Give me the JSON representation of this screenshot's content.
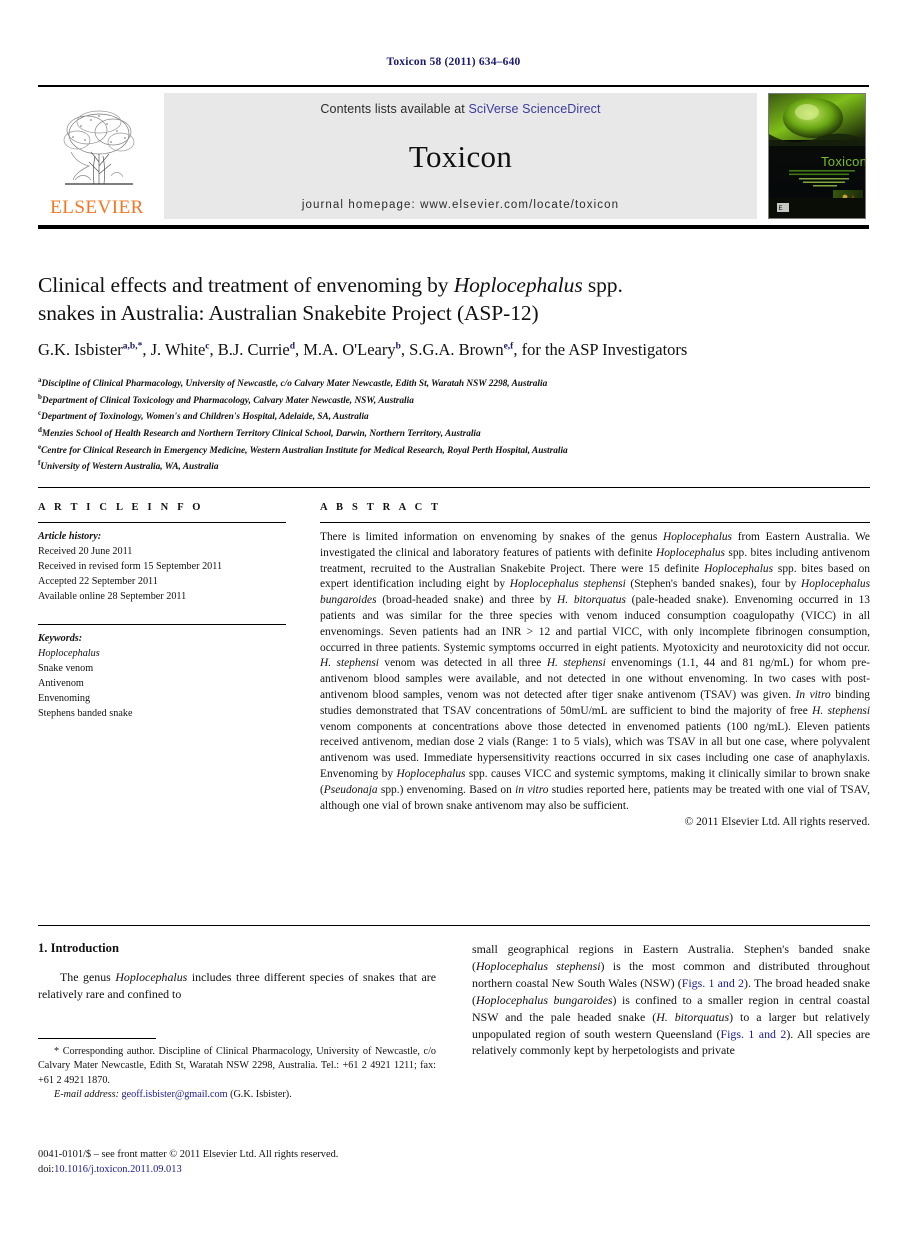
{
  "running_head": "Toxicon 58 (2011) 634–640",
  "masthead": {
    "publisher_name": "ELSEVIER",
    "contents_prefix": "Contents lists available at ",
    "contents_link": "SciVerse ScienceDirect",
    "journal_name": "Toxicon",
    "homepage": "journal homepage: www.elsevier.com/locate/toxicon",
    "cover_title": "Toxicon",
    "link_color": "#3b3b9e",
    "brand_color": "#F27621"
  },
  "article": {
    "title_line1": "Clinical effects and treatment of envenoming by ",
    "title_italic": "Hoplocephalus",
    "title_line1_end": " spp.",
    "title_line2": "snakes in Australia: Australian Snakebite Project (ASP-12)",
    "authors_plain": "G.K. Isbister a,b,*, J. White c, B.J. Currie d, M.A. O'Leary b, S.G.A. Brown e,f, for the ASP Investigators",
    "affiliations": [
      {
        "sup": "a",
        "text": "Discipline of Clinical Pharmacology, University of Newcastle, c/o Calvary Mater Newcastle, Edith St, Waratah NSW 2298, Australia"
      },
      {
        "sup": "b",
        "text": "Department of Clinical Toxicology and Pharmacology, Calvary Mater Newcastle, NSW, Australia"
      },
      {
        "sup": "c",
        "text": "Department of Toxinology, Women's and Children's Hospital, Adelaide, SA, Australia"
      },
      {
        "sup": "d",
        "text": "Menzies School of Health Research and Northern Territory Clinical School, Darwin, Northern Territory, Australia"
      },
      {
        "sup": "e",
        "text": "Centre for Clinical Research in Emergency Medicine, Western Australian Institute for Medical Research, Royal Perth Hospital, Australia"
      },
      {
        "sup": "f",
        "text": "University of Western Australia, WA, Australia"
      }
    ]
  },
  "article_info": {
    "heading": "A R T I C L E   I N F O",
    "history_label": "Article history:",
    "history": [
      "Received 20 June 2011",
      "Received in revised form 15 September 2011",
      "Accepted 22 September 2011",
      "Available online 28 September 2011"
    ],
    "keywords_label": "Keywords:",
    "keywords": [
      "Hoplocephalus",
      "Snake venom",
      "Antivenom",
      "Envenoming",
      "Stephens banded snake"
    ]
  },
  "abstract": {
    "heading": "A B S T R A C T",
    "copyright": "© 2011 Elsevier Ltd. All rights reserved."
  },
  "introduction": {
    "heading": "1. Introduction",
    "left_para": "The genus Hoplocephalus includes three different species of snakes that are relatively rare and confined to",
    "right_para": "small geographical regions in Eastern Australia. Stephen's banded snake (Hoplocephalus stephensi) is the most common and distributed throughout northern coastal New South Wales (NSW) (Figs. 1 and 2). The broad headed snake (Hoplocephalus bungaroides) is confined to a smaller region in central coastal NSW and the pale headed snake (H. bitorquatus) to a larger but relatively unpopulated region of south western Queensland (Figs. 1 and 2). All species are relatively commonly kept by herpetologists and private"
  },
  "footnotes": {
    "corresponding": "* Corresponding author. Discipline of Clinical Pharmacology, University of Newcastle, c/o Calvary Mater Newcastle, Edith St, Waratah NSW 2298, Australia. Tel.: +61 2 4921 1211; fax: +61 2 4921 1870.",
    "email_label": "E-mail address:",
    "email": "geoff.isbister@gmail.com",
    "email_suffix": "(G.K. Isbister).",
    "issn_line": "0041-0101/$ – see front matter © 2011 Elsevier Ltd. All rights reserved.",
    "doi_label": "doi:",
    "doi": "10.1016/j.toxicon.2011.09.013"
  },
  "fig_links": {
    "figs_1_2": "Figs. 1 and 2"
  }
}
